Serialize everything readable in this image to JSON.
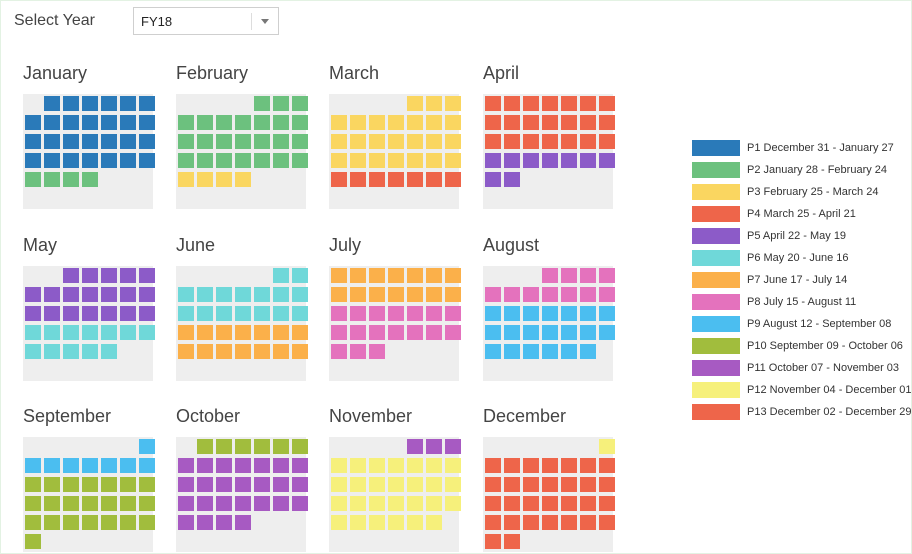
{
  "header": {
    "select_label": "Select Year",
    "year_value": "FY18",
    "dropdown_icon": "chevron-down-icon"
  },
  "periods": [
    {
      "code": "P1",
      "label": "P1 December 31 - January 27",
      "color": "#2a7ab9"
    },
    {
      "code": "P2",
      "label": "P2 January 28 - February 24",
      "color": "#6cc17e"
    },
    {
      "code": "P3",
      "label": "P3 February 25 - March 24",
      "color": "#fad660"
    },
    {
      "code": "P4",
      "label": "P4 March 25 - April 21",
      "color": "#ee654a"
    },
    {
      "code": "P5",
      "label": "P5 April 22 - May 19",
      "color": "#8c5bc8"
    },
    {
      "code": "P6",
      "label": "P6 May 20 - June 16",
      "color": "#6fd8d9"
    },
    {
      "code": "P7",
      "label": "P7 June 17 - July 14",
      "color": "#fbb04a"
    },
    {
      "code": "P8",
      "label": "P8 July 15 - August 11",
      "color": "#e472bd"
    },
    {
      "code": "P9",
      "label": "P9 August 12 - September 08",
      "color": "#4bbef0"
    },
    {
      "code": "P10",
      "label": "P10 September 09 - October 06",
      "color": "#a1bd3d"
    },
    {
      "code": "P11",
      "label": "P11 October 07 - November 03",
      "color": "#a75ac2"
    },
    {
      "code": "P12",
      "label": "P12 November 04 - December 01",
      "color": "#f6f07b"
    },
    {
      "code": "P13",
      "label": "P13 December 02 - December 29",
      "color": "#ee654a"
    }
  ],
  "months": [
    {
      "name": "January",
      "first_weekday": 1,
      "days": 31,
      "first_period": 1,
      "first_days": 27
    },
    {
      "name": "February",
      "first_weekday": 4,
      "days": 28,
      "first_period": 2,
      "first_days": 24
    },
    {
      "name": "March",
      "first_weekday": 4,
      "days": 31,
      "first_period": 3,
      "first_days": 24
    },
    {
      "name": "April",
      "first_weekday": 0,
      "days": 30,
      "first_period": 4,
      "first_days": 21
    },
    {
      "name": "May",
      "first_weekday": 2,
      "days": 31,
      "first_period": 5,
      "first_days": 19
    },
    {
      "name": "June",
      "first_weekday": 5,
      "days": 30,
      "first_period": 6,
      "first_days": 16
    },
    {
      "name": "July",
      "first_weekday": 0,
      "days": 31,
      "first_period": 7,
      "first_days": 14
    },
    {
      "name": "August",
      "first_weekday": 3,
      "days": 31,
      "first_period": 8,
      "first_days": 11
    },
    {
      "name": "September",
      "first_weekday": 6,
      "days": 30,
      "first_period": 9,
      "first_days": 8
    },
    {
      "name": "October",
      "first_weekday": 1,
      "days": 31,
      "first_period": 10,
      "first_days": 6
    },
    {
      "name": "November",
      "first_weekday": 4,
      "days": 30,
      "first_period": 11,
      "first_days": 3
    },
    {
      "name": "December",
      "first_weekday": 6,
      "days": 31,
      "first_period": 12,
      "first_days": 1
    }
  ]
}
